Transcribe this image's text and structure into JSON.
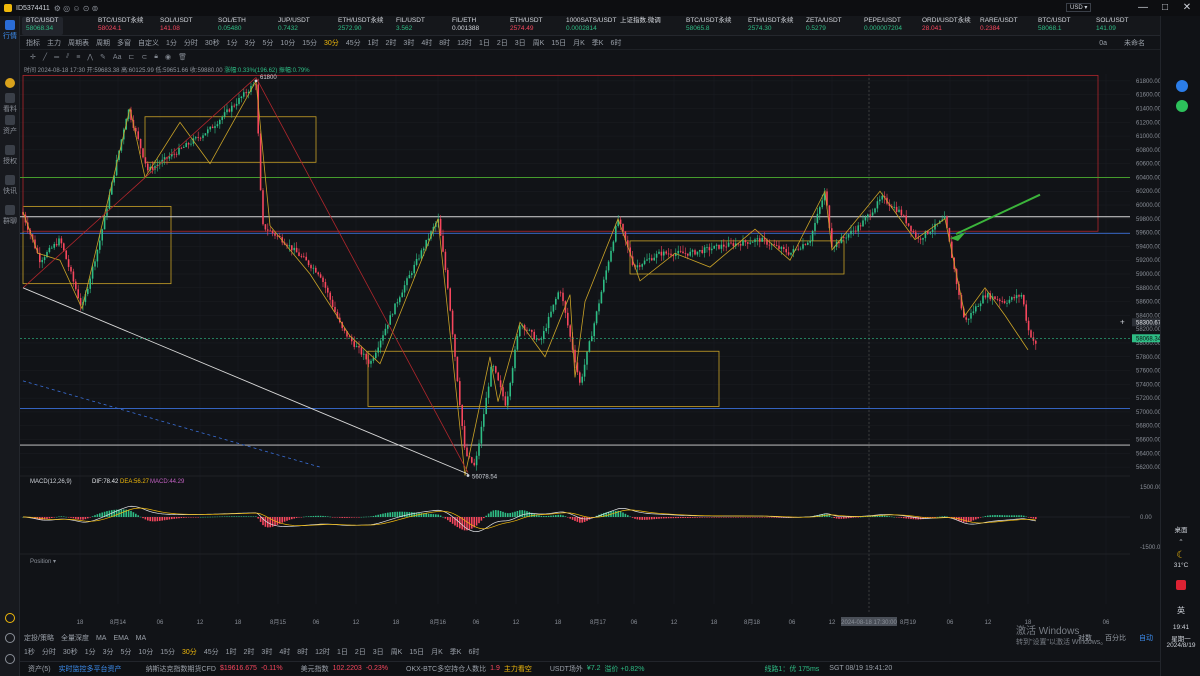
{
  "titlebar": {
    "account": "ID5374411",
    "minimize": "—",
    "maximize": "□",
    "close": "✕"
  },
  "leftbar": [
    {
      "label": "行情",
      "icon": "chart-icon"
    },
    {
      "label": "",
      "icon": "shield-icon"
    },
    {
      "label": "看料",
      "icon": "news-icon"
    },
    {
      "label": "资产",
      "icon": "wallet-icon"
    },
    {
      "label": "授权",
      "icon": "key-icon"
    },
    {
      "label": "快讯",
      "icon": "bolt-icon"
    },
    {
      "label": "群聊",
      "icon": "chat-icon"
    }
  ],
  "tickers": [
    {
      "name": "BTC/USDT",
      "price": "58068.34",
      "color": "#2ebd85"
    },
    {
      "name": "BTC/USDT永续",
      "price": "58024.1",
      "color": "#f6465d"
    },
    {
      "name": "SOL/USDT",
      "price": "141.08",
      "color": "#f6465d"
    },
    {
      "name": "SOL/ETH",
      "price": "0.05480",
      "color": "#2ebd85"
    },
    {
      "name": "JUP/USDT",
      "price": "0.7432",
      "color": "#2ebd85"
    },
    {
      "name": "ETH/USDT永续",
      "price": "2572.90",
      "color": "#2ebd85"
    },
    {
      "name": "FIL/USDT",
      "price": "3.562",
      "color": "#2ebd85"
    },
    {
      "name": "FIL/ETH",
      "price": "0.001388",
      "color": "#d4d7dd"
    },
    {
      "name": "ETH/USDT",
      "price": "2574.49",
      "color": "#f6465d"
    },
    {
      "name": "1000SATS/USDT",
      "price": "0.0002814",
      "color": "#2ebd85"
    },
    {
      "name": "上证指数.微调",
      "price": "",
      "color": "#d4d7dd"
    },
    {
      "name": "BTC/USDT永续",
      "price": "58065.8",
      "color": "#2ebd85"
    },
    {
      "name": "ETH/USDT永续",
      "price": "2574.30",
      "color": "#2ebd85"
    },
    {
      "name": "ZETA/USDT",
      "price": "0.5279",
      "color": "#2ebd85"
    },
    {
      "name": "PEPE/USDT",
      "price": "0.000007204",
      "color": "#2ebd85"
    },
    {
      "name": "ORDI/USDT永续",
      "price": "28.041",
      "color": "#f6465d"
    },
    {
      "name": "RARE/USDT",
      "price": "0.2384",
      "color": "#f6465d"
    },
    {
      "name": "BTC/USDT",
      "price": "58068.1",
      "color": "#2ebd85"
    },
    {
      "name": "SOL/USDT",
      "price": "141.09",
      "color": "#2ebd85"
    }
  ],
  "toolbar1": {
    "items": [
      "指标",
      "主力",
      "周期表",
      "周期",
      "多窗",
      "自定义",
      "1分",
      "分时",
      "30秒",
      "1分",
      "3分",
      "5分",
      "10分",
      "15分",
      "30分",
      "45分",
      "1时",
      "2时",
      "3时",
      "4时",
      "8时",
      "12时",
      "1日",
      "2日",
      "3日",
      "周K",
      "15日",
      "月K",
      "季K",
      "6时"
    ],
    "active_index": 14,
    "right": [
      "0a",
      "未命名"
    ]
  },
  "infoline": {
    "time": "时间 2024-08-18 17:30",
    "open": "开:59683.38",
    "high": "高:60125.99",
    "low": "低:59651.66",
    "close": "收:59880.00",
    "change": "涨幅:0.33%(196.62)",
    "amplitude": "振幅:0.79%"
  },
  "chart_data": {
    "type": "candlestick",
    "ylim": [
      56100,
      61900
    ],
    "yticks": [
      61800,
      61600,
      61400,
      61200,
      61000,
      60800,
      60600,
      60400,
      60200,
      60000,
      59800,
      59600,
      59400,
      59200,
      59000,
      58800,
      58600,
      58400,
      58200,
      58000,
      57800,
      57600,
      57400,
      57200,
      57000,
      56800,
      56600,
      56400,
      56200
    ],
    "xticks": [
      "18",
      "8月14",
      "06",
      "12",
      "18",
      "8月15",
      "06",
      "12",
      "18",
      "8月16",
      "06",
      "12",
      "18",
      "8月17",
      "06",
      "12",
      "18",
      "8月18",
      "06",
      "12",
      "2024-08-18 17:30:00",
      "8月19",
      "06",
      "12",
      "18",
      "06"
    ],
    "high_label": "61800",
    "low_label": "56078.54",
    "price_tags": [
      "58300.67",
      "58068.34"
    ],
    "hlines": [
      {
        "price": 60400,
        "color": "#4caf2f"
      },
      {
        "price": 59830,
        "color": "#d8d8d8"
      },
      {
        "price": 59590,
        "color": "#3a6fd8"
      },
      {
        "price": 57050,
        "color": "#3a6fd8"
      },
      {
        "price": 56520,
        "color": "#d8d8d8"
      },
      {
        "price": 59150,
        "color": "#c22"
      }
    ],
    "macd": {
      "label": "MACD(12,26,9)",
      "dif": "DIF:78.42",
      "dea": "DEA:56.27",
      "macd": "MACD:44.29",
      "yticks": [
        "1500.00",
        "0.00",
        "-1500.00"
      ]
    },
    "position_label": "Position"
  },
  "bottom": {
    "row1": [
      "定投/策略",
      "全量深度",
      "MA",
      "EMA",
      "",
      "MA"
    ],
    "row2": [
      "1秒",
      "分时",
      "30秒",
      "1分",
      "3分",
      "5分",
      "10分",
      "15分",
      "30分",
      "45分",
      "1时",
      "2时",
      "3时",
      "4时",
      "8时",
      "12时",
      "1日",
      "2日",
      "3日",
      "周K",
      "15日",
      "月K",
      "季K",
      "6时"
    ],
    "row2_active": 8,
    "right": [
      "对数",
      "百分比",
      "自动"
    ]
  },
  "status": {
    "asset": "资产(5)",
    "monitor": "实时监控多平台资产",
    "nasdaq_label": "纳斯达克指数期货CFD",
    "nasdaq": "$19616.675",
    "nasdaq_chg": "-0.11%",
    "dxy_label": "美元指数",
    "dxy": "102.2203",
    "dxy_chg": "-0.23%",
    "okx_label": "OKX-BTC多空持仓人数比",
    "okx": "1.9",
    "okx_tag": "主力看空",
    "usdt_label": "USDT场外",
    "usdt": "¥7.2",
    "usdt_chg": "溢价 +0.82%",
    "line": "线路1：优 175ms",
    "clock": "SGT 08/19 19:41:20"
  },
  "windows_watermark": {
    "line1": "激活 Windows",
    "line2": "转到\"设置\"以激活 Windows。"
  },
  "tray": {
    "desktop": "桌面",
    "weather": "31°C",
    "lang": "英",
    "time": "19:41",
    "weekday": "星期一",
    "date": "2024/8/19"
  }
}
